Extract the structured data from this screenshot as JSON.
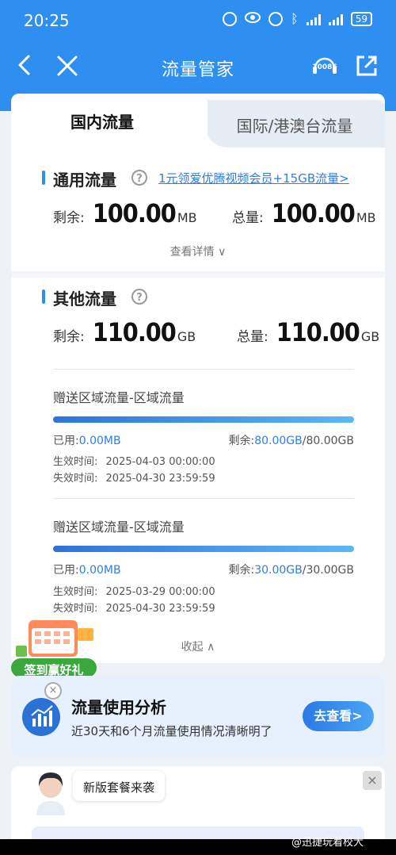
{
  "status_bar": {
    "time": "20:25",
    "battery": "59"
  },
  "nav": {
    "title": "流量管家",
    "service_label": "10086"
  },
  "tabs": [
    {
      "label": "国内流量",
      "active": true
    },
    {
      "label": "国际/港澳台流量",
      "active": false
    }
  ],
  "general": {
    "title": "通用流量",
    "help": "?",
    "promo": "1元领爱优腾视频会员+15GB流量>",
    "remain_label": "剩余:",
    "remain_value": "100.00",
    "remain_unit": "MB",
    "total_label": "总量:",
    "total_value": "100.00",
    "total_unit": "MB",
    "detail_link": "查看详情 ∨"
  },
  "other": {
    "title": "其他流量",
    "help": "?",
    "remain_label": "剩余:",
    "remain_value": "110.00",
    "remain_unit": "GB",
    "total_label": "总量:",
    "total_value": "110.00",
    "total_unit": "GB",
    "packages": [
      {
        "name": "赠送区域流量-区域流量",
        "progress": 1.0,
        "used_label": "已用:",
        "used_value": "0.00MB",
        "remain_label": "剩余:",
        "remain_value": "80.00GB",
        "remain_total": "/80.00GB",
        "start_label": "生效时间:",
        "start_value": "2025-04-03 00:00:00",
        "end_label": "失效时间:",
        "end_value": "2025-04-30 23:59:59"
      },
      {
        "name": "赠送区域流量-区域流量",
        "progress": 1.0,
        "used_label": "已用:",
        "used_value": "0.00MB",
        "remain_label": "剩余:",
        "remain_value": "30.00GB",
        "remain_total": "/30.00GB",
        "start_label": "生效时间:",
        "start_value": "2025-03-29 00:00:00",
        "end_label": "失效时间:",
        "end_value": "2025-04-30 23:59:59"
      }
    ],
    "collapse_link": "收起 ∧"
  },
  "sign_badge": {
    "label": "签到赢好礼"
  },
  "analysis": {
    "title": "流量使用分析",
    "subtitle": "近30天和6个月流量使用情况清晰明了",
    "button": "去查看>",
    "close": "×"
  },
  "bottom": {
    "bubble": "新版套餐来袭",
    "close": "×"
  },
  "watermark": "@迅捷玩着校大",
  "colors": {
    "primary": "#2f8ff0",
    "link": "#2f7ee0",
    "page_bg": "#eef2f7"
  }
}
